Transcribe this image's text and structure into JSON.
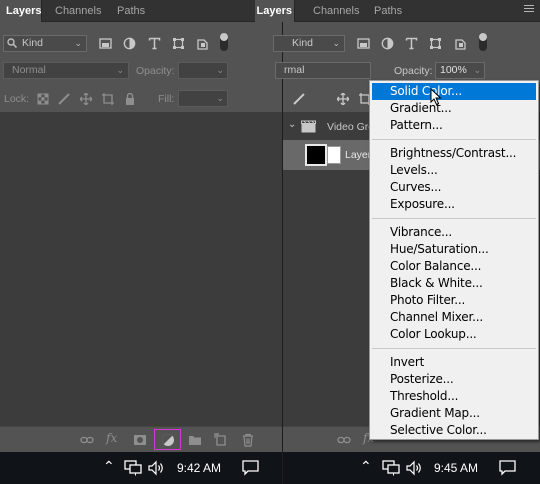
{
  "left_panel": {
    "tabs": [
      "Layers",
      "Channels",
      "Paths"
    ],
    "kind_label": "Kind",
    "blend_mode": "Normal",
    "opacity_label": "Opacity:",
    "opacity_value": "",
    "lock_label": "Lock:",
    "fill_label": "Fill:",
    "fill_value": "",
    "time": "9:42 AM"
  },
  "right_panel": {
    "tabs": [
      "Layers",
      "Channels",
      "Paths"
    ],
    "kind_label": "Kind",
    "blend_mode": "rmal",
    "opacity_label": "Opacity:",
    "opacity_value": "100%",
    "video_group_label": "Video Gro",
    "layer_label": "Layer",
    "time": "9:45 AM"
  },
  "adjustment_menu": {
    "groups": [
      [
        "Solid Color...",
        "Gradient...",
        "Pattern..."
      ],
      [
        "Brightness/Contrast...",
        "Levels...",
        "Curves...",
        "Exposure..."
      ],
      [
        "Vibrance...",
        "Hue/Saturation...",
        "Color Balance...",
        "Black & White...",
        "Photo Filter...",
        "Channel Mixer...",
        "Color Lookup..."
      ],
      [
        "Invert",
        "Posterize...",
        "Threshold...",
        "Gradient Map...",
        "Selective Color..."
      ]
    ],
    "highlighted": "Solid Color..."
  },
  "colors": {
    "panel_bg": "#535353",
    "dark_bg": "#3c3c3c",
    "menu_highlight": "#0078d7",
    "adjust_button_outline": "#d23ad2",
    "taskbar_bg": "#101318"
  },
  "icons": {
    "bottom_bar": [
      "link-icon",
      "fx-icon",
      "mask-icon",
      "adjustment-layer-icon",
      "folder-icon",
      "new-layer-icon",
      "trash-icon"
    ],
    "taskbar": [
      "show-hidden-icons-chevron",
      "network-icon",
      "volume-icon",
      "notification-icon"
    ]
  }
}
